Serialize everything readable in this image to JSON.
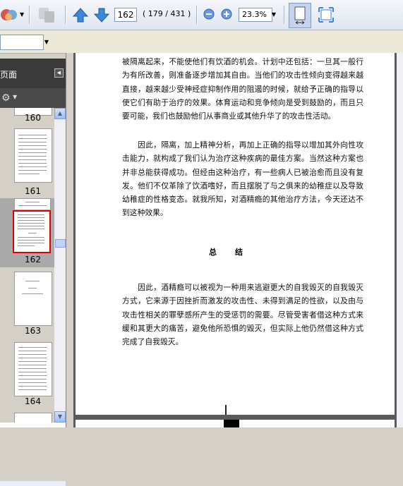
{
  "toolbar": {
    "page_number": "162",
    "page_count": "( 179 / 431 )",
    "zoom": "23.3%"
  },
  "nav": {
    "title": "页面",
    "thumbnails": [
      {
        "label": "160"
      },
      {
        "label": "161"
      },
      {
        "label": "162"
      },
      {
        "label": "163"
      },
      {
        "label": "164"
      }
    ]
  },
  "document": {
    "paragraphs": [
      "被隔离起来，不能使他们有饮酒的机会。计划中还包括：一旦其一般行为有所改善，则准备逐步增加其自由。当他们的攻击性倾向变得越来越直接，越来越少受神经症抑制作用的阻遏的时候，就给予正确的指导以使它们有助于治疗的效果。体育运动和竞争倾向是受到鼓励的，而且只要可能，我们也鼓励他们从事商业或其他升华了的攻击性活动。",
      "　　因此，隔离，加上精神分析，再加上正确的指导以增加其外向性攻击能力，就构成了我们认为治疗这种疾病的最佳方案。当然这种方案也并非总能获得成功。但经由这种治疗，有一些病人已被治愈而且没有复发。他们不仅革除了饮酒嗜好，而且摆脱了与之俱来的幼稚症以及导致幼稚症的性格变态。就我所知，对酒精瘾的其他治疗方法，今天还达不到这种效果。",
      "　　因此，酒精瘾可以被视为一种用来逃避更大的自我毁灭的自我毁灭方式，它来源于因挫折而激发的攻击性、未得到满足的性欲，以及由与攻击性相关的罪孽感所产生的受惩罚的需要。尽管受害者借这种方式来缓和其更大的痛苦，避免他所恐惧的毁灭，但实际上他仍然借这种方式完成了自我毁灭。"
    ],
    "heading": "总结"
  }
}
